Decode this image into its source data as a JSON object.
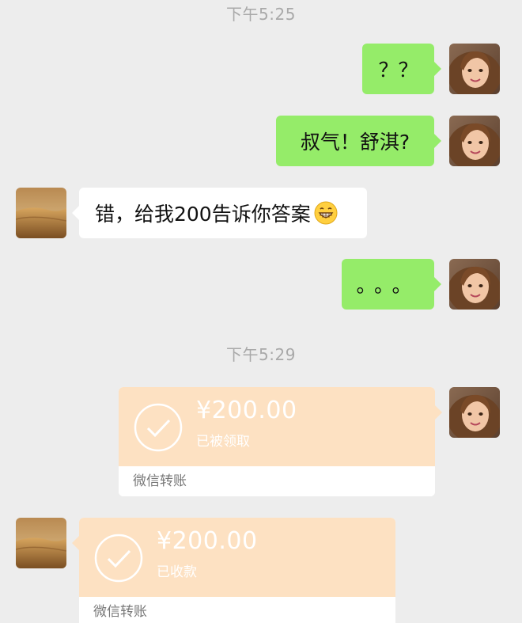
{
  "chat": {
    "timestamps": [
      "下午5:25",
      "下午5:29"
    ],
    "messages": [
      {
        "sender": "me",
        "text": "？？"
      },
      {
        "sender": "me",
        "text": "叔气！舒淇?"
      },
      {
        "sender": "other",
        "text": "错，给我200告诉你答案",
        "emoji": "grin-icon"
      },
      {
        "sender": "me",
        "text": "。。。"
      }
    ],
    "transfers": [
      {
        "sender": "me",
        "amount": "¥200.00",
        "status": "已被领取",
        "label": "微信转账"
      },
      {
        "sender": "other",
        "amount": "¥200.00",
        "status": "已收款",
        "label": "微信转账"
      }
    ]
  },
  "colors": {
    "background": "#ededed",
    "my_bubble": "#95ec69",
    "their_bubble": "#ffffff",
    "transfer_top": "#fde1c2",
    "timestamp_text": "#a9a9a9"
  }
}
